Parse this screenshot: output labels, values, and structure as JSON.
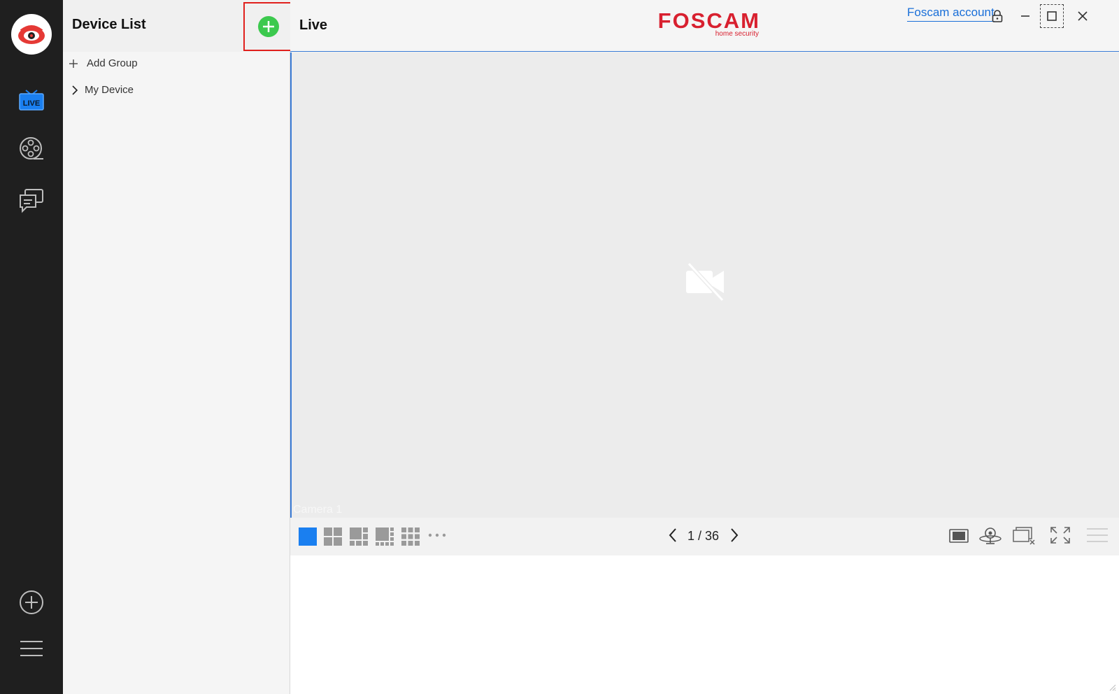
{
  "colors": {
    "rail_bg": "#1f1f1f",
    "accent_blue": "#1a6fd8",
    "add_green": "#3cc94e",
    "highlight_red": "#e0201d",
    "brand_red": "#d8202f"
  },
  "device_list": {
    "title": "Device List",
    "add_group_label": "Add Group",
    "my_device_label": "My Device"
  },
  "topbar": {
    "title": "Live",
    "brand_name": "FOSCAM",
    "brand_tagline": "home security",
    "account_link": "Foscam account"
  },
  "video": {
    "camera_label": "Camera 1"
  },
  "toolbar": {
    "page_indicator": "1 / 36"
  },
  "rail": {
    "live_icon_text": "LIVE"
  }
}
